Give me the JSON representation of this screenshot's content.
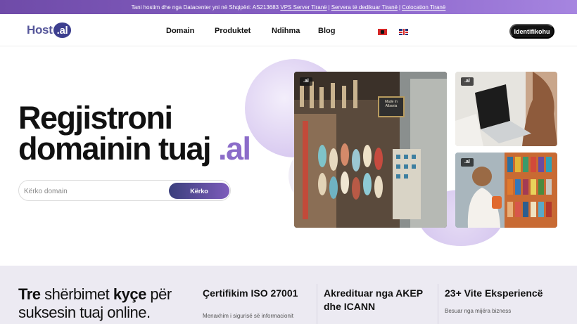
{
  "topbar": {
    "text": "Tani hostim dhe nga Datacenter yni në Shqipëri: AS213683",
    "links": [
      "VPS Server Tiranë",
      "Servera të dedikuar Tiranë",
      "Colocation Tiranë"
    ],
    "separator": "|"
  },
  "header": {
    "logo_text": "Host",
    "logo_badge": ".al",
    "menu": [
      "Domain",
      "Produktet",
      "Ndihma",
      "Blog"
    ],
    "languages": [
      "albanian-flag-icon",
      "english-flag-icon"
    ],
    "login_label": "Identifikohu"
  },
  "hero": {
    "title_line1": "Regjistroni",
    "title_line2": "domainin tuaj",
    "title_tld": ".al",
    "search_placeholder": "Kërko domain",
    "search_button": "Kërko"
  },
  "gallery": {
    "tags": [
      ".al",
      ".al",
      ".al"
    ],
    "shop_sign": "Made In Albania"
  },
  "features": {
    "title_bold1": "Tre",
    "title_mid": " shërbimet ",
    "title_bold2": "kyçe",
    "title_end": " për",
    "title_line2": "suksesin tuaj online.",
    "items": [
      {
        "title": "Çertifikim ISO 27001",
        "desc": "Menaxhim i sigurisë së informacionit"
      },
      {
        "title": "Akredituar nga AKEP dhe ICANN",
        "desc": ""
      },
      {
        "title": "23+ Vite Eksperiencë",
        "desc": "Besuar nga mijëra bizness"
      }
    ]
  },
  "colors": {
    "accent": "#8b6cc9",
    "topbar_start": "#6f4ba8",
    "topbar_end": "#a685e0",
    "dark_button": "#131313",
    "band": "#eceaf2"
  }
}
